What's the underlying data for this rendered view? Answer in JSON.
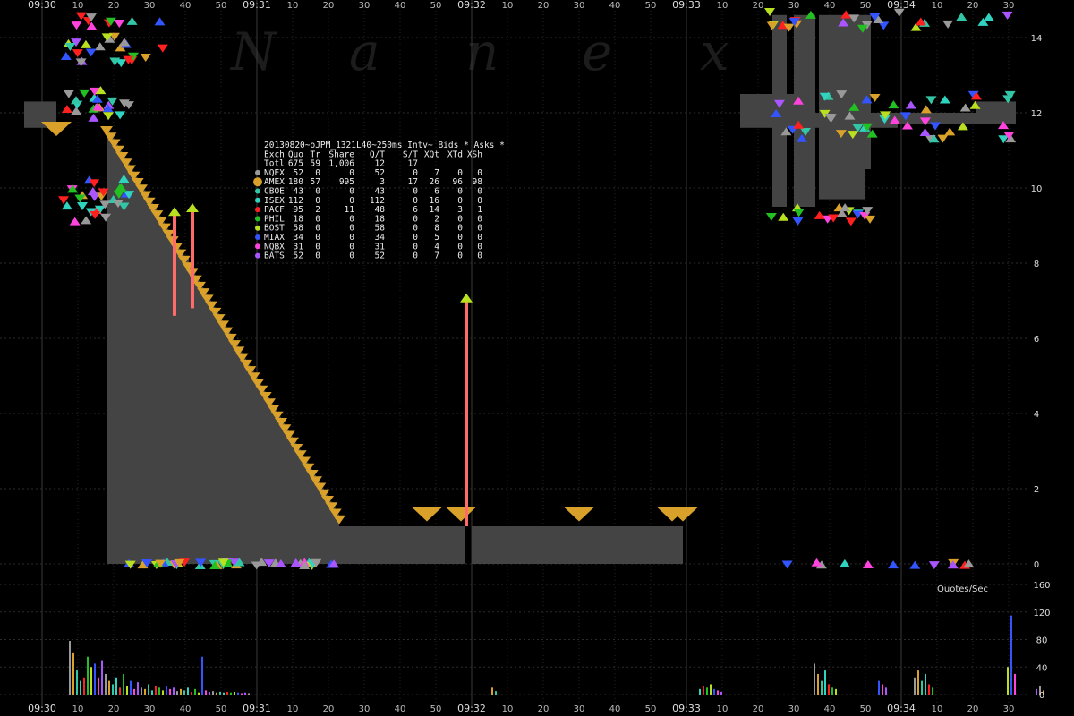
{
  "chart_data": {
    "type": "scatter",
    "watermark_letters": [
      "N",
      "a",
      "n",
      "e",
      "x"
    ],
    "time_axis": {
      "minute_labels": [
        "09:30",
        "09:31",
        "09:32",
        "09:33",
        "09:34"
      ],
      "second_labels": [
        "10",
        "20",
        "30",
        "40",
        "50"
      ],
      "tail_labels": [
        "10",
        "20",
        "30"
      ]
    },
    "price_axis": {
      "range": [
        0,
        15
      ],
      "ticks": [
        "0",
        "2",
        "4",
        "6",
        "8",
        "10",
        "12",
        "14"
      ]
    },
    "rate_axis": {
      "label": "Quotes/Sec",
      "range": [
        0,
        160
      ],
      "ticks": [
        "0",
        "40",
        "80",
        "120",
        "160"
      ]
    },
    "legend": {
      "title": "20130820~oJPM_1321L40~250ms Intv~ Bids * Asks *",
      "header": [
        "Exch",
        "Quo",
        "Tr",
        "Share",
        "Q/T",
        "S/T",
        "XQt",
        "XTd",
        "XSh"
      ],
      "rows": [
        {
          "exch": "Totl",
          "quo": "675",
          "tr": "59",
          "share": "1,006",
          "qt": "12",
          "st": "17",
          "xqt": "",
          "xtd": "",
          "xsh": "",
          "color": ""
        },
        {
          "exch": "NQEX",
          "quo": "52",
          "tr": "0",
          "share": "0",
          "qt": "52",
          "st": "0",
          "xqt": "7",
          "xtd": "0",
          "xsh": "0",
          "color": "#999999"
        },
        {
          "exch": "AMEX",
          "quo": "180",
          "tr": "57",
          "share": "995",
          "qt": "3",
          "st": "17",
          "xqt": "26",
          "xtd": "96",
          "xsh": "98",
          "color": "#d9a12a"
        },
        {
          "exch": "CBOE",
          "quo": "43",
          "tr": "0",
          "share": "0",
          "qt": "43",
          "st": "0",
          "xqt": "6",
          "xtd": "0",
          "xsh": "0",
          "color": "#33c6a6"
        },
        {
          "exch": "ISEX",
          "quo": "112",
          "tr": "0",
          "share": "0",
          "qt": "112",
          "st": "0",
          "xqt": "16",
          "xtd": "0",
          "xsh": "0",
          "color": "#30d2c0"
        },
        {
          "exch": "PACF",
          "quo": "95",
          "tr": "2",
          "share": "11",
          "qt": "48",
          "st": "6",
          "xqt": "14",
          "xtd": "3",
          "xsh": "1",
          "color": "#ff2020"
        },
        {
          "exch": "PHIL",
          "quo": "18",
          "tr": "0",
          "share": "0",
          "qt": "18",
          "st": "0",
          "xqt": "2",
          "xtd": "0",
          "xsh": "0",
          "color": "#22c022"
        },
        {
          "exch": "BOST",
          "quo": "58",
          "tr": "0",
          "share": "0",
          "qt": "58",
          "st": "0",
          "xqt": "8",
          "xtd": "0",
          "xsh": "0",
          "color": "#b8e020"
        },
        {
          "exch": "MIAX",
          "quo": "34",
          "tr": "0",
          "share": "0",
          "qt": "34",
          "st": "0",
          "xqt": "5",
          "xtd": "0",
          "xsh": "0",
          "color": "#3355ff"
        },
        {
          "exch": "NQBX",
          "quo": "31",
          "tr": "0",
          "share": "0",
          "qt": "31",
          "st": "0",
          "xqt": "4",
          "xtd": "0",
          "xsh": "0",
          "color": "#ff44dd"
        },
        {
          "exch": "BATS",
          "quo": "52",
          "tr": "0",
          "share": "0",
          "qt": "52",
          "st": "0",
          "xqt": "7",
          "xtd": "0",
          "xsh": "0",
          "color": "#aa55ff"
        }
      ]
    },
    "colors": {
      "spread": "#444444",
      "trade": "#ff6b6b",
      "amex": "#d9a12a",
      "grid": "#2a2a2a"
    },
    "spread_segments": [
      {
        "t0": -5,
        "t1": 4,
        "bid": 11.6,
        "ask": 12.3
      },
      {
        "t0": 25,
        "t1": 27,
        "bid": 0,
        "ask": 9.8
      },
      {
        "t0": 29,
        "t1": 31,
        "bid": 0,
        "ask": 9.1
      },
      {
        "t0": 33,
        "t1": 35.5,
        "bid": 0,
        "ask": 8.6
      },
      {
        "t0": 36.5,
        "t1": 41,
        "bid": 0,
        "ask": 8.2
      },
      {
        "t0": 41.5,
        "t1": 44,
        "bid": 0,
        "ask": 6.8
      },
      {
        "t0": 44,
        "t1": 83,
        "bid": 0,
        "ask": 1.0
      },
      {
        "t0": 83,
        "t1": 100,
        "bid": 0,
        "ask": 1.0
      },
      {
        "t0": 100,
        "t1": 118,
        "bid": 0,
        "ask": 1.0
      },
      {
        "t0": 120,
        "t1": 179,
        "bid": 0,
        "ask": 1.0
      },
      {
        "t0": 204,
        "t1": 208,
        "bid": 9.5,
        "ask": 14.6
      },
      {
        "t0": 210,
        "t1": 216,
        "bid": 9.5,
        "ask": 14.6
      },
      {
        "t0": 217,
        "t1": 230,
        "bid": 9.7,
        "ask": 14.6
      },
      {
        "t0": 230,
        "t1": 231.5,
        "bid": 10.5,
        "ask": 14.6
      },
      {
        "t0": 195,
        "t1": 210,
        "bid": 11.6,
        "ask": 12.5
      },
      {
        "t0": 216,
        "t1": 239,
        "bid": 11.6,
        "ask": 12.0
      },
      {
        "t0": 239,
        "t1": 261,
        "bid": 11.7,
        "ask": 12.0
      },
      {
        "t0": 261,
        "t1": 272,
        "bid": 11.7,
        "ask": 12.3
      }
    ],
    "ask_staircase": {
      "t_start": 18,
      "price_start": 11.5,
      "t_end": 83,
      "price_end": 1.15,
      "steps": 60
    },
    "trade_spikes": [
      {
        "t": 42,
        "price_low": 6.8,
        "price_high": 9.5
      },
      {
        "t": 37,
        "price_low": 6.6,
        "price_high": 9.4
      },
      {
        "t": 118.5,
        "price_low": 1.0,
        "price_high": 7.1
      }
    ],
    "amex_ask_markers": [
      {
        "t": 4,
        "price": 11.5
      },
      {
        "t": 107.5,
        "price": 1.25
      },
      {
        "t": 117,
        "price": 1.25
      },
      {
        "t": 150,
        "price": 1.25
      },
      {
        "t": 176,
        "price": 1.25
      },
      {
        "t": 179,
        "price": 1.25
      }
    ],
    "quote_rate": {
      "x": [
        0,
        1,
        2,
        3,
        4,
        5,
        6,
        7,
        8,
        9,
        10,
        11,
        12,
        13,
        14,
        15,
        16,
        17,
        18,
        19,
        20,
        21,
        22,
        23,
        24,
        25,
        26,
        27,
        28,
        29,
        30,
        31,
        32,
        33,
        34,
        35,
        36,
        37,
        38,
        39,
        40,
        41,
        42,
        43,
        44,
        45,
        46,
        47,
        48,
        49,
        50,
        118,
        119,
        176,
        177,
        178,
        179,
        180,
        181,
        182,
        208,
        209,
        210,
        211,
        212,
        213,
        214,
        226,
        227,
        228,
        236,
        237,
        238,
        239,
        240,
        241,
        262,
        263,
        264,
        270,
        271,
        272
      ],
      "values": [
        78,
        60,
        35,
        20,
        25,
        55,
        40,
        45,
        25,
        50,
        30,
        20,
        15,
        25,
        10,
        30,
        12,
        20,
        8,
        18,
        10,
        8,
        15,
        6,
        12,
        10,
        6,
        12,
        8,
        10,
        5,
        8,
        6,
        10,
        4,
        8,
        3,
        55,
        6,
        4,
        5,
        3,
        4,
        3,
        4,
        3,
        4,
        3,
        2,
        3,
        2,
        10,
        5,
        8,
        12,
        10,
        15,
        8,
        6,
        4,
        45,
        30,
        20,
        35,
        15,
        10,
        8,
        20,
        15,
        10,
        25,
        35,
        20,
        30,
        15,
        10,
        40,
        115,
        30,
        8,
        12,
        6
      ]
    }
  }
}
